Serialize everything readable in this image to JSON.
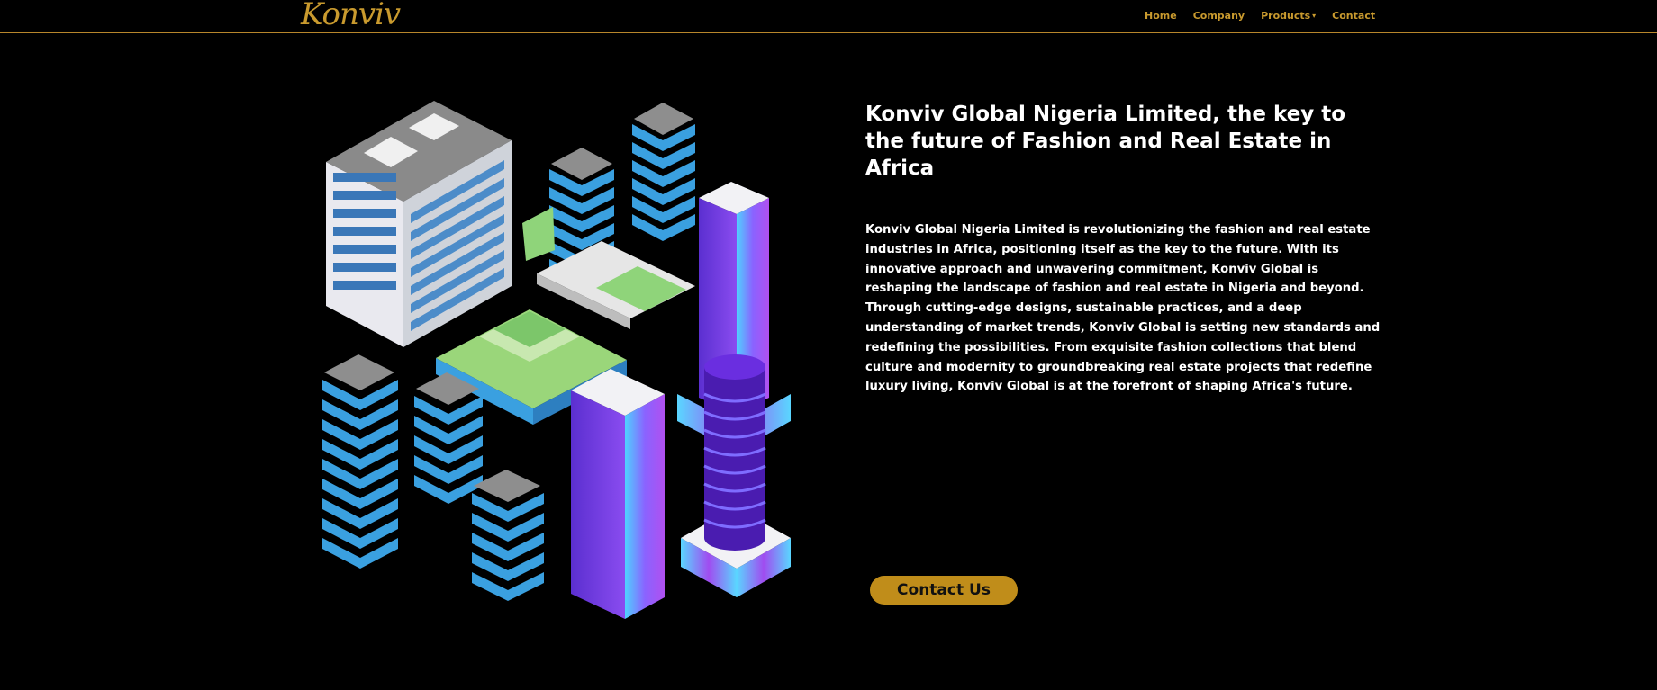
{
  "nav": {
    "logo": "Konviv",
    "items": [
      {
        "label": "Home"
      },
      {
        "label": "Company"
      },
      {
        "label": "Products",
        "has_dropdown": true
      },
      {
        "label": "Contact"
      }
    ]
  },
  "hero": {
    "title": "Konviv Global Nigeria Limited, the key to the future of Fashion and Real Estate in Africa",
    "description": "Konviv Global Nigeria Limited is revolutionizing the fashion and real estate industries in Africa, positioning itself as the key to the future. With its innovative approach and unwavering commitment, Konviv Global is reshaping the landscape of fashion and real estate in Nigeria and beyond. Through cutting-edge designs, sustainable practices, and a deep understanding of market trends, Konviv Global is setting new standards and redefining the possibilities. From exquisite fashion collections that blend culture and modernity to groundbreaking real estate projects that redefine luxury living, Konviv Global is at the forefront of shaping Africa's future.",
    "cta_label": "Contact Us",
    "illustration": "isometric-city-buildings"
  },
  "colors": {
    "background": "#000000",
    "accent_gold": "#c99a2e",
    "button_gold": "#c08d1a",
    "text": "#ffffff"
  }
}
